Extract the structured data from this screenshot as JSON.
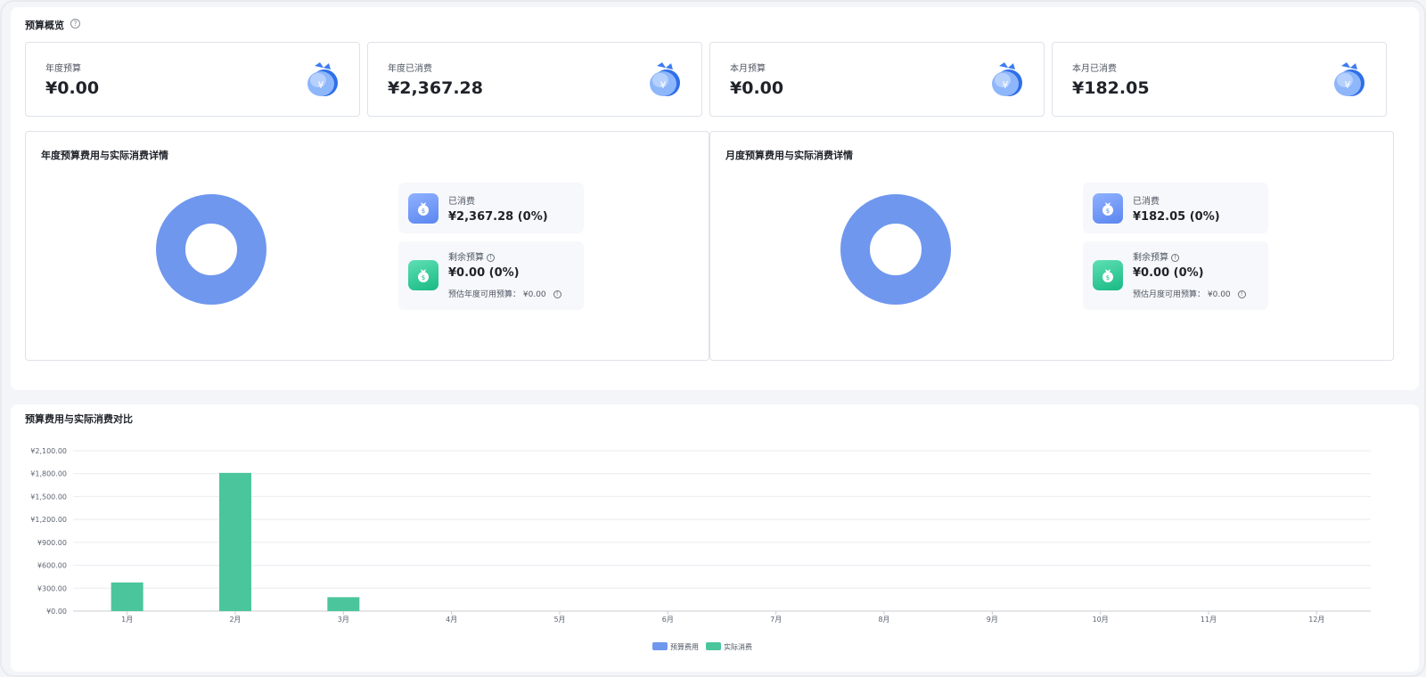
{
  "overview": {
    "title": "预算概览",
    "help_symbol": "?",
    "cards": [
      {
        "label": "年度预算",
        "value": "¥0.00",
        "icon": "money-bag-icon"
      },
      {
        "label": "年度已消费",
        "value": "¥2,367.28",
        "icon": "money-bag-icon"
      },
      {
        "label": "本月预算",
        "value": "¥0.00",
        "icon": "money-bag-icon"
      },
      {
        "label": "本月已消费",
        "value": "¥182.05",
        "icon": "money-bag-icon"
      }
    ]
  },
  "annual_detail": {
    "title": "年度预算费用与实际消费详情",
    "spent_label": "已消费",
    "spent_value": "¥2,367.28 (0%)",
    "remain_label": "剩余预算",
    "remain_value": "¥0.00 (0%)",
    "estimate_label": "预估年度可用预算：",
    "estimate_value": "¥0.00"
  },
  "monthly_detail": {
    "title": "月度预算费用与实际消费详情",
    "spent_label": "已消费",
    "spent_value": "¥182.05 (0%)",
    "remain_label": "剩余预算",
    "remain_value": "¥0.00 (0%)",
    "estimate_label": "预估月度可用预算：",
    "estimate_value": "¥0.00"
  },
  "colors": {
    "budget": "#6f97ee",
    "actual": "#4bc69c",
    "donut": "#6f97ee"
  },
  "comparison": {
    "title": "预算费用与实际消费对比"
  },
  "chart_data": {
    "type": "bar",
    "categories": [
      "1月",
      "2月",
      "3月",
      "4月",
      "5月",
      "6月",
      "7月",
      "8月",
      "9月",
      "10月",
      "11月",
      "12月"
    ],
    "y_ticks": [
      "¥0.00",
      "¥300.00",
      "¥600.00",
      "¥900.00",
      "¥1,200.00",
      "¥1,500.00",
      "¥1,800.00",
      "¥2,100.00"
    ],
    "ylim": [
      0,
      2100
    ],
    "grid": true,
    "legend_position": "bottom-center",
    "series": [
      {
        "name": "预算费用",
        "values": [
          0,
          0,
          0,
          0,
          0,
          0,
          0,
          0,
          0,
          0,
          0,
          0
        ]
      },
      {
        "name": "实际消费",
        "values": [
          375,
          1810,
          182.05,
          0,
          0,
          0,
          0,
          0,
          0,
          0,
          0,
          0
        ]
      }
    ]
  }
}
